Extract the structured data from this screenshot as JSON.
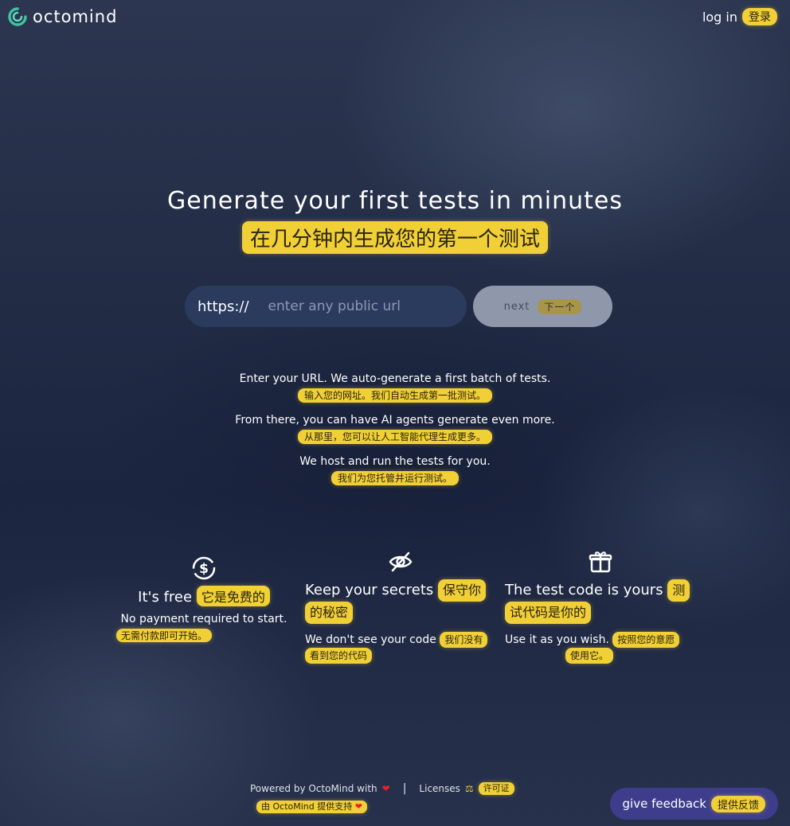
{
  "brand": {
    "name": "octomind"
  },
  "header": {
    "login_label": "log in",
    "login_zh": "登录"
  },
  "hero": {
    "title": "Generate your first tests in minutes",
    "title_zh": "在几分钟内生成您的第一个测试"
  },
  "url_form": {
    "prefix": "https://",
    "placeholder": "enter any public url",
    "value": "",
    "next_label": "next",
    "next_zh": "下一个"
  },
  "description": [
    {
      "en": "Enter your URL. We auto-generate a first batch of tests.",
      "zh": "输入您的网址。我们自动生成第一批测试。"
    },
    {
      "en": "From there, you can have AI agents generate even more.",
      "zh": "从那里，您可以让人工智能代理生成更多。"
    },
    {
      "en": "We host and run the tests for you.",
      "zh": "我们为您托管并运行测试。"
    }
  ],
  "features": [
    {
      "icon": "dollar-refresh-icon",
      "title": "It's free",
      "title_zh": "它是免费的",
      "subtitle": "No payment required to start.",
      "subtitle_zh": "无需付款即可开始。"
    },
    {
      "icon": "eye-off-icon",
      "title": "Keep your secrets",
      "title_zh_a": "保守你",
      "title_zh_b": "的秘密",
      "subtitle": "We don't see your code",
      "subtitle_zh_a": "我们没有",
      "subtitle_zh_b": "看到您的代码"
    },
    {
      "icon": "gift-icon",
      "title": "The test code is yours",
      "title_zh_a": "测",
      "title_zh_b": "试代码是你的",
      "subtitle": "Use it as you wish.",
      "subtitle_zh_a": "按照您的意愿",
      "subtitle_zh_b": "使用它。"
    }
  ],
  "footer": {
    "powered_by": "Powered by OctoMind with",
    "separator": "|",
    "licenses": "Licenses",
    "licenses_zh": "许可证",
    "powered_by_zh": "由 OctoMind 提供支持"
  },
  "feedback": {
    "label": "give feedback",
    "label_zh": "提供反馈"
  },
  "colors": {
    "highlight": "#f1cf36",
    "button": "#8f98ab",
    "input_bg": "#2b3b5e",
    "feedback_bg": "#3e3d8c",
    "brand_mark": "#3fc3a0"
  }
}
